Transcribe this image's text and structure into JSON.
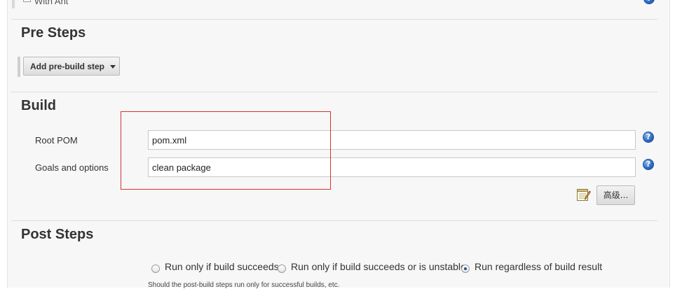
{
  "top": {
    "checkbox_label": "With Ant"
  },
  "pre_steps": {
    "title": "Pre Steps",
    "add_button_label": "Add pre-build step"
  },
  "build": {
    "title": "Build",
    "root_pom": {
      "label": "Root POM",
      "value": "pom.xml"
    },
    "goals": {
      "label": "Goals and options",
      "value": "clean package"
    },
    "advanced_button_label": "高级..."
  },
  "post_steps": {
    "title": "Post Steps",
    "options": [
      {
        "label": "Run only if build succeeds",
        "selected": false
      },
      {
        "label": "Run only if build succeeds or is unstable",
        "selected": false
      },
      {
        "label": "Run regardless of build result",
        "selected": true
      }
    ],
    "hint": "Should the post-build steps run only for successful builds, etc."
  },
  "help_icon_glyph": "?",
  "colors": {
    "panel_bg": "#f7f7f7",
    "highlight_box": "#d9302b",
    "help_blue": "#2f6fc8"
  }
}
